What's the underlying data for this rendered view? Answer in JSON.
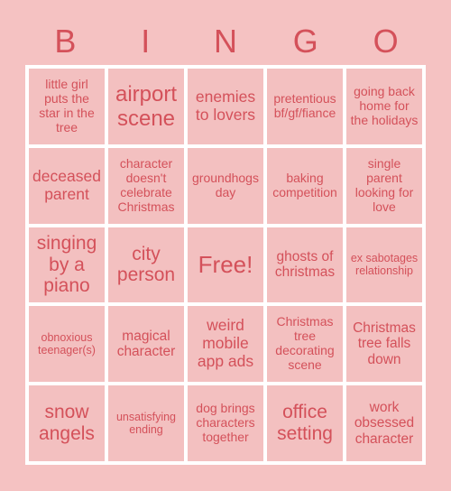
{
  "card": {
    "header_letters": [
      "B",
      "I",
      "N",
      "G",
      "O"
    ],
    "colors": {
      "background": "#f5c2c2",
      "cell_background": "#f3c0c0",
      "gridline": "#ffffff",
      "text": "#d4515a"
    },
    "grid": {
      "rows": 5,
      "columns": 5,
      "cells": [
        {
          "text": "little girl puts the star in the tree",
          "size": "s"
        },
        {
          "text": "airport scene",
          "size": "xxl"
        },
        {
          "text": "enemies to lovers",
          "size": "l"
        },
        {
          "text": "pretentious bf/gf/fiance",
          "size": "s"
        },
        {
          "text": "going back home for the holidays",
          "size": "s"
        },
        {
          "text": "deceased parent",
          "size": "l"
        },
        {
          "text": "character doesn't celebrate Christmas",
          "size": "s"
        },
        {
          "text": "groundhogs day",
          "size": "s"
        },
        {
          "text": "baking competition",
          "size": "s"
        },
        {
          "text": "single parent looking for love",
          "size": "s"
        },
        {
          "text": "singing by a piano",
          "size": "xl"
        },
        {
          "text": "city person",
          "size": "xl"
        },
        {
          "text": "Free!",
          "size": "free"
        },
        {
          "text": "ghosts of christmas",
          "size": "m"
        },
        {
          "text": "ex sabotages relationship",
          "size": "xs"
        },
        {
          "text": "obnoxious teenager(s)",
          "size": "xs"
        },
        {
          "text": "magical character",
          "size": "m"
        },
        {
          "text": "weird mobile app ads",
          "size": "l"
        },
        {
          "text": "Christmas tree decorating scene",
          "size": "s"
        },
        {
          "text": "Christmas tree falls down",
          "size": "m"
        },
        {
          "text": "snow angels",
          "size": "xl"
        },
        {
          "text": "unsatisfying ending",
          "size": "xs"
        },
        {
          "text": "dog brings characters together",
          "size": "s"
        },
        {
          "text": "office setting",
          "size": "xl"
        },
        {
          "text": "work obsessed character",
          "size": "m"
        }
      ]
    }
  }
}
